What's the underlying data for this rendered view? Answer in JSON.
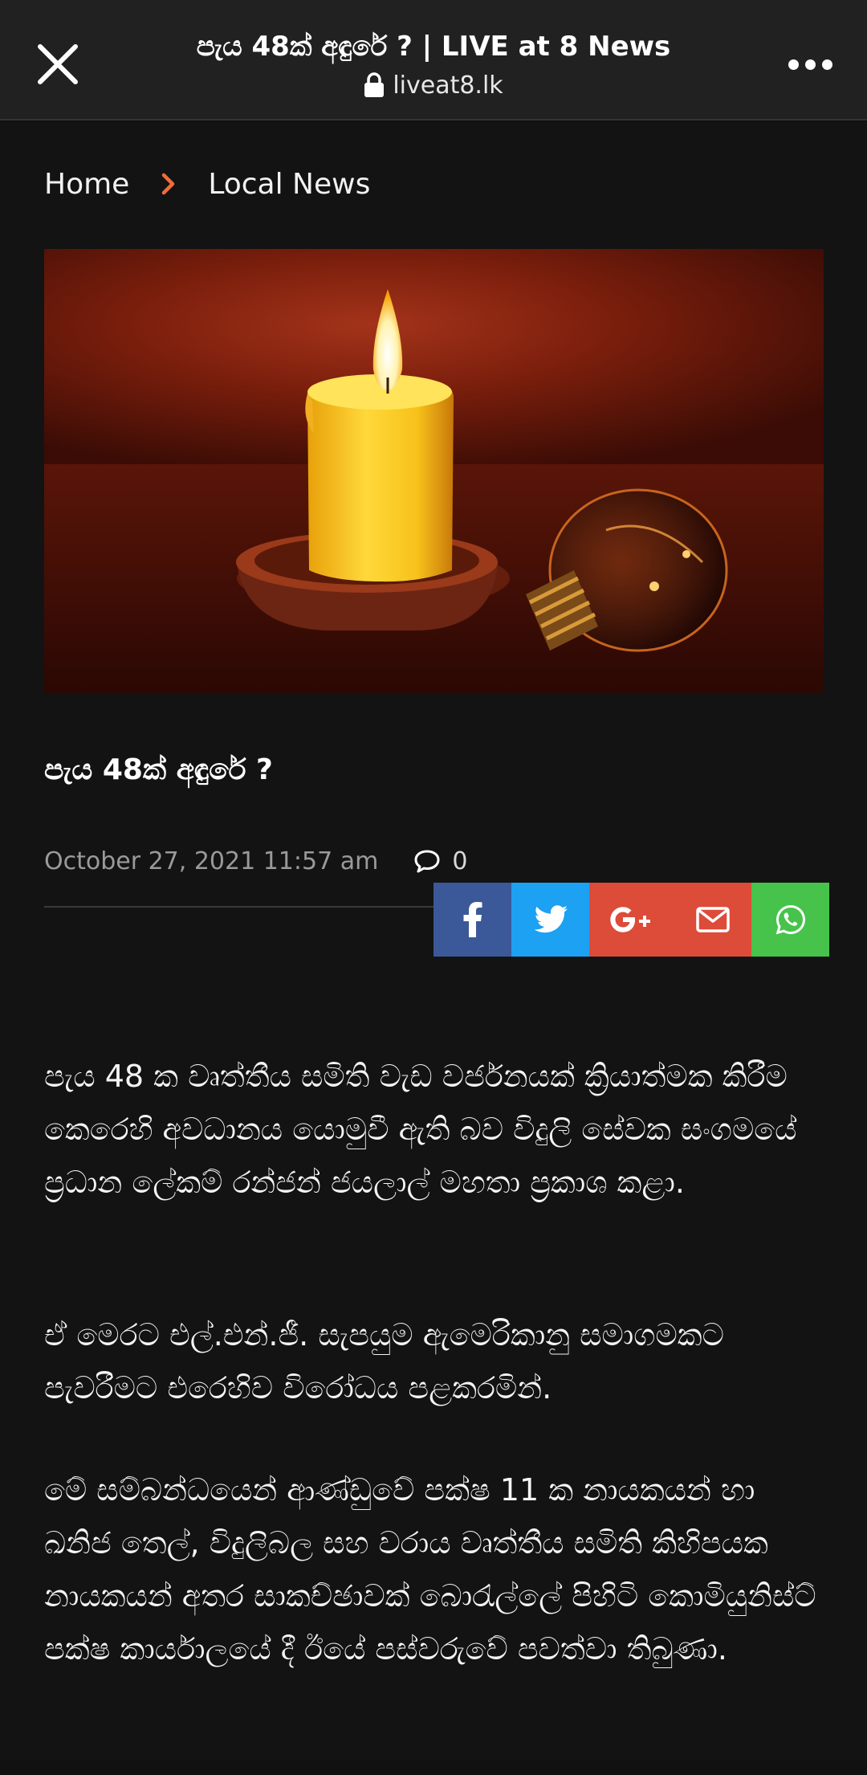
{
  "browser": {
    "page_title": "පැය 48ක් අඳුරේ ? | LIVE at 8 News",
    "url": "liveat8.lk",
    "icons": {
      "close": "close-icon",
      "lock": "lock-icon",
      "menu": "more-icon"
    }
  },
  "breadcrumb": {
    "home": "Home",
    "separator_icon": "chevron-right-icon",
    "current": "Local  News",
    "separator_color": "#f26b3a"
  },
  "article": {
    "title": "පැය  48ක්  අඳුරේ  ?",
    "date": "October  27,  2021  11:57  am",
    "comment_count": "0",
    "paragraphs": [
      "පැය 48 ක වෘත්තීය සමිති වැඩ වර්ජනයක් ක්‍රියාත්මක කිරීම කෙරෙහි අවධානය යොමුවී ඇති බව විදුලි සේවක සංගමයේ ප්‍රධාන ලේකම් රන්ජන් ජයලාල් මහතා ප්‍රකාශ කළා.",
      "ඒ මෙරට එල්.එන්.ජී. සැපයුම ඇමෙරිකානු සමාගමකට පැවරීමට එරෙහිව විරෝධය පළකරමින්.",
      "මේ සම්බන්ධයෙන් ආණ්ඩුවේ පක්ෂ 11 ක නායකයන් හා ඛනිජ තෙල්, විදුලිබල සහ වරාය වෘත්තීය සමිති කිහිපයක නායකයන් අතර සාකච්ඡාවක් බොරැල්ලේ පිහිටි කොමියුනිස්ට් පක්ෂ කාර්යාලයේ දී ඊයේ පස්වරුවේ පවත්වා තිබුණා."
    ]
  },
  "share": {
    "buttons": [
      {
        "network": "facebook",
        "icon": "facebook-icon",
        "color": "#3b5998"
      },
      {
        "network": "twitter",
        "icon": "twitter-icon",
        "color": "#1da1f2"
      },
      {
        "network": "google-plus",
        "icon": "google-plus-icon",
        "color": "#dd4b39"
      },
      {
        "network": "email",
        "icon": "email-icon",
        "color": "#dd4b39"
      },
      {
        "network": "whatsapp",
        "icon": "whatsapp-icon",
        "color": "#47c34b"
      }
    ]
  }
}
